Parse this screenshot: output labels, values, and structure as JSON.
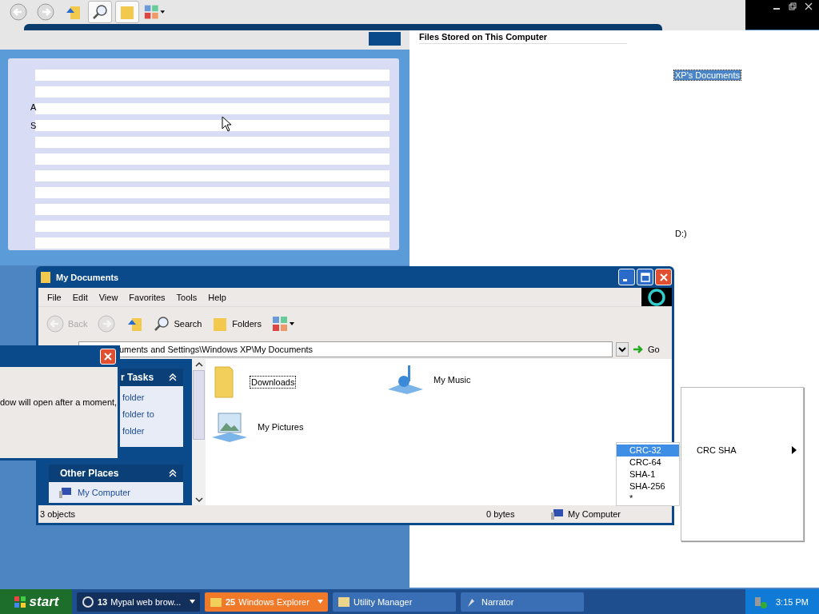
{
  "top_toolbar": [
    {
      "kind": "back",
      "pressed": false
    },
    {
      "kind": "forward",
      "pressed": false
    },
    {
      "kind": "up",
      "pressed": false
    },
    {
      "kind": "search",
      "pressed": true
    },
    {
      "kind": "folders",
      "pressed": true
    },
    {
      "kind": "views",
      "pressed": false
    }
  ],
  "background_window": {
    "heading": "Files Stored on This Computer",
    "fragments": [
      "A",
      "S"
    ],
    "items": [
      {
        "label": "XP's Documents",
        "selected": true
      },
      {
        "label": "D:)",
        "selected": false
      }
    ]
  },
  "explorer": {
    "title": "My Documents",
    "menu": [
      "File",
      "Edit",
      "View",
      "Favorites",
      "Tools",
      "Help"
    ],
    "toolbar": [
      {
        "kind": "back",
        "label": "Back",
        "disabled": true
      },
      {
        "kind": "forward",
        "disabled": true
      },
      {
        "kind": "up",
        "disabled": false
      },
      {
        "kind": "search",
        "label": "Search",
        "disabled": false
      },
      {
        "kind": "folders",
        "label": "Folders",
        "disabled": false
      },
      {
        "kind": "views",
        "disabled": false
      }
    ],
    "address": "uments and Settings\\Windows XP\\My Documents",
    "go": "Go",
    "tasks": {
      "title": "r Tasks",
      "links": [
        "folder",
        "folder to",
        "folder"
      ]
    },
    "other_places": {
      "title": "Other Places",
      "links": [
        "My Computer"
      ]
    },
    "items": [
      {
        "kind": "folder",
        "label": "Downloads",
        "focused": true
      },
      {
        "kind": "music",
        "label": "My Music",
        "focused": false
      },
      {
        "kind": "pictures",
        "label": "My Pictures",
        "focused": false
      }
    ],
    "status": [
      "3 objects",
      "0 bytes",
      "My Computer"
    ]
  },
  "dialog": {
    "message": "dow will open after a moment,"
  },
  "context_menu": {
    "items": [
      {
        "label": "CRC-32",
        "selected": true
      },
      {
        "label": "CRC-64",
        "selected": false
      },
      {
        "label": "SHA-1",
        "selected": false
      },
      {
        "label": "SHA-256",
        "selected": false
      },
      {
        "label": "*",
        "selected": false
      }
    ],
    "submenu": {
      "label": "CRC SHA"
    }
  },
  "taskbar": {
    "start": "start",
    "tasks": [
      {
        "kind": "browser",
        "count": "13",
        "label": "Mypal web brow...",
        "selected": false
      },
      {
        "kind": "explorer",
        "count": "25",
        "label": "Windows Explorer",
        "selected": true
      },
      {
        "kind": "utility",
        "label": "Utility Manager",
        "selected": false
      },
      {
        "kind": "narrator",
        "label": "Narrator",
        "selected": false
      }
    ],
    "clock": "3:15 PM"
  }
}
